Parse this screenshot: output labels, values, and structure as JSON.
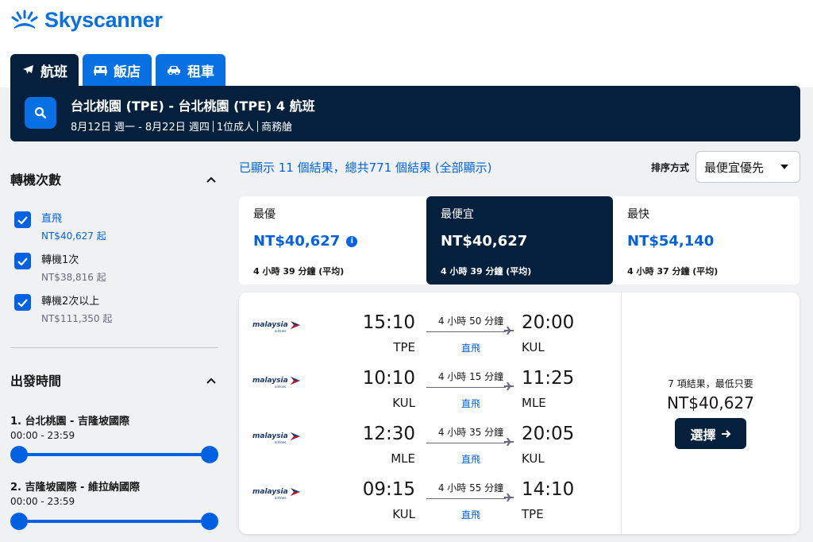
{
  "brand": {
    "name": "Skyscanner",
    "icon": "skyscanner-sunrise-icon",
    "color": "#0770e3"
  },
  "tabs": [
    {
      "label": "航班",
      "icon": "plane-icon",
      "active": true
    },
    {
      "label": "飯店",
      "icon": "bed-icon",
      "active": false
    },
    {
      "label": "租車",
      "icon": "car-icon",
      "active": false
    }
  ],
  "search": {
    "route": "台北桃園 (TPE) - 台北桃園 (TPE) 4 航班",
    "dates": "8月12日 週一 - 8月22日 週四",
    "passengers": "1位成人",
    "cabin": "商務艙"
  },
  "filters": {
    "stops_title": "轉機次數",
    "stops": [
      {
        "label": "直飛",
        "price": "NT$40,627 起",
        "checked": true,
        "highlight": true
      },
      {
        "label": "轉機1次",
        "price": "NT$38,816 起",
        "checked": true,
        "highlight": false
      },
      {
        "label": "轉機2次以上",
        "price": "NT$111,350 起",
        "checked": true,
        "highlight": false
      }
    ],
    "departure_title": "出發時間",
    "segments": [
      {
        "title": "1. 台北桃園 - 吉隆坡國際",
        "range": "00:00 - 23:59"
      },
      {
        "title": "2. 吉隆坡國際 - 維拉納國際",
        "range": "00:00 - 23:59"
      }
    ]
  },
  "results": {
    "summary": "已顯示 11 個結果，總共771 個結果 (全部顯示)",
    "sort_label": "排序方式",
    "sort_value": "最便宜優先"
  },
  "price_cards": [
    {
      "label": "最優",
      "price": "NT$40,627",
      "duration": "4 小時 39 分鐘 (平均)",
      "active": false,
      "info": true
    },
    {
      "label": "最便宜",
      "price": "NT$40,627",
      "duration": "4 小時 39 分鐘 (平均)",
      "active": true,
      "info": false
    },
    {
      "label": "最快",
      "price": "NT$54,140",
      "duration": "4 小時 37 分鐘 (平均)",
      "active": false,
      "info": false
    }
  ],
  "itinerary": {
    "airline": "malaysia",
    "airline_sub": "airlines",
    "legs": [
      {
        "dep_time": "15:10",
        "dep_code": "TPE",
        "duration": "4 小時 50 分鐘",
        "stops": "直飛",
        "arr_time": "20:00",
        "arr_code": "KUL"
      },
      {
        "dep_time": "10:10",
        "dep_code": "KUL",
        "duration": "4 小時 15 分鐘",
        "stops": "直飛",
        "arr_time": "11:25",
        "arr_code": "MLE"
      },
      {
        "dep_time": "12:30",
        "dep_code": "MLE",
        "duration": "4 小時 35 分鐘",
        "stops": "直飛",
        "arr_time": "20:05",
        "arr_code": "KUL"
      },
      {
        "dep_time": "09:15",
        "dep_code": "KUL",
        "duration": "4 小時 55 分鐘",
        "stops": "直飛",
        "arr_time": "14:10",
        "arr_code": "TPE"
      }
    ],
    "result_count": "7 項結果，最低只要",
    "price": "NT$40,627",
    "select_label": "選擇"
  },
  "colors": {
    "dark_navy": "#05203c",
    "accent_blue": "#0062e3",
    "brand_blue": "#0770e3",
    "background": "#eff1f2"
  }
}
